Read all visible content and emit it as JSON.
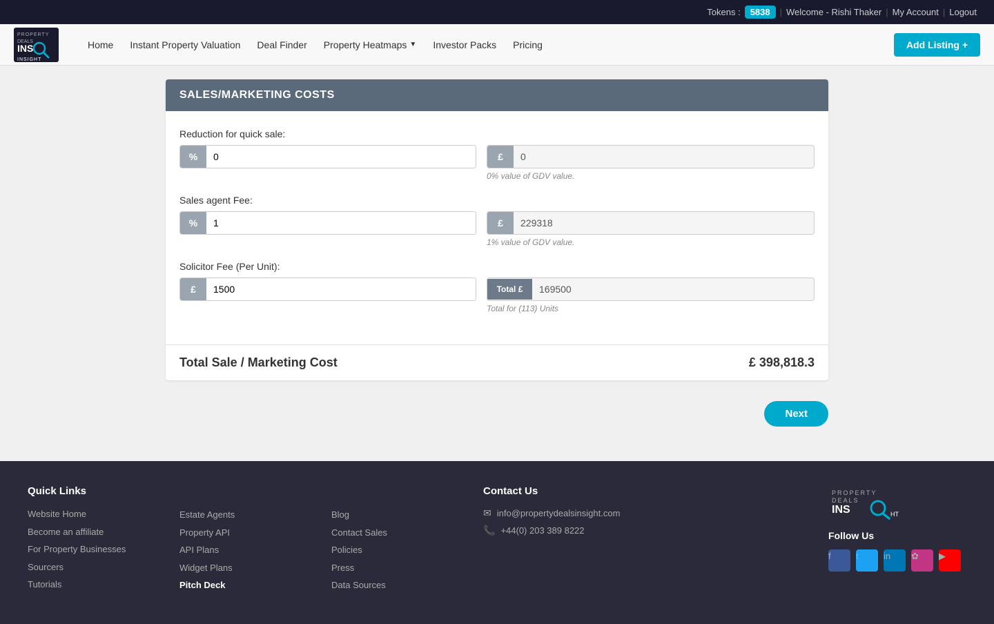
{
  "navbar": {
    "top": {
      "tokens_label": "Tokens :",
      "tokens_value": "5838",
      "welcome_text": "Welcome - Rishi Thaker",
      "my_account": "My Account",
      "logout": "Logout"
    },
    "logo": {
      "line1": "PROPERTY",
      "line2": "DEALS",
      "line3": "INSIGHT"
    },
    "nav_links": [
      {
        "label": "Home",
        "id": "home"
      },
      {
        "label": "Instant Property Valuation",
        "id": "ipv"
      },
      {
        "label": "Deal Finder",
        "id": "deal-finder"
      },
      {
        "label": "Property Heatmaps",
        "id": "heatmaps",
        "has_dropdown": true
      },
      {
        "label": "Investor Packs",
        "id": "investor-packs"
      },
      {
        "label": "Pricing",
        "id": "pricing"
      }
    ],
    "add_listing_label": "Add Listing +"
  },
  "section": {
    "title": "SALES/MARKETING COSTS",
    "fields": {
      "reduction_label": "Reduction for quick sale:",
      "reduction_percent": "0",
      "reduction_value": "0",
      "reduction_hint": "0% value of GDV value.",
      "sales_agent_label": "Sales agent Fee:",
      "sales_agent_percent": "1",
      "sales_agent_value": "229318",
      "sales_agent_hint": "1% value of GDV value.",
      "solicitor_label": "Solicitor Fee (Per Unit):",
      "solicitor_value": "1500",
      "solicitor_total_label": "Total £",
      "solicitor_total": "169500",
      "solicitor_hint": "Total for (113) Units"
    },
    "total_label": "Total Sale / Marketing Cost",
    "total_value": "£ 398,818.3"
  },
  "next_button": "Next",
  "footer": {
    "quick_links": {
      "title": "Quick Links",
      "items": [
        {
          "label": "Website Home",
          "highlight": false
        },
        {
          "label": "Become an affiliate",
          "highlight": false
        },
        {
          "label": "For Property Businesses",
          "highlight": false
        },
        {
          "label": "Sourcers",
          "highlight": false
        },
        {
          "label": "Tutorials",
          "highlight": false
        }
      ]
    },
    "col2": {
      "items": [
        {
          "label": "Estate Agents"
        },
        {
          "label": "Property API"
        },
        {
          "label": "API Plans"
        },
        {
          "label": "Widget Plans"
        },
        {
          "label": "Pitch Deck",
          "highlight": true
        }
      ]
    },
    "col3": {
      "items": [
        {
          "label": "Blog"
        },
        {
          "label": "Contact Sales"
        },
        {
          "label": "Policies"
        },
        {
          "label": "Press"
        },
        {
          "label": "Data Sources"
        }
      ]
    },
    "contact": {
      "title": "Contact Us",
      "email": "info@propertydealsinsight.com",
      "phone": "+44(0) 203 389 8222"
    },
    "follow_us": "Follow Us",
    "social": [
      "f",
      "t",
      "in",
      "ig",
      "yt"
    ]
  }
}
